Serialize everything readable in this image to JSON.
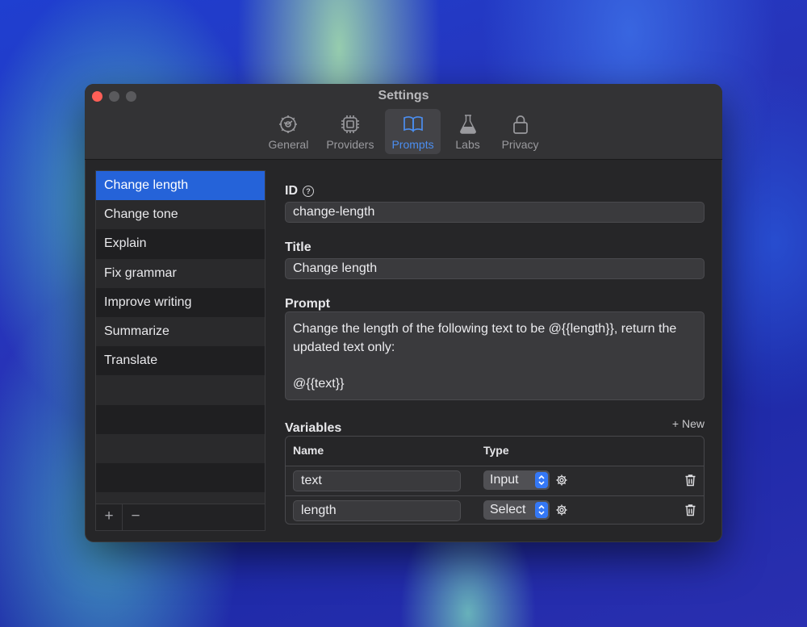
{
  "window": {
    "title": "Settings",
    "controls": [
      "close",
      "minimize",
      "zoom"
    ]
  },
  "toolbar": {
    "tabs": [
      {
        "label": "General",
        "icon": "gear-wheel-icon"
      },
      {
        "label": "Providers",
        "icon": "chip-icon"
      },
      {
        "label": "Prompts",
        "icon": "book-icon",
        "active": true
      },
      {
        "label": "Labs",
        "icon": "flask-icon"
      },
      {
        "label": "Privacy",
        "icon": "lock-icon"
      }
    ]
  },
  "sidebar": {
    "items": [
      {
        "label": "Change length",
        "selected": true
      },
      {
        "label": "Change tone"
      },
      {
        "label": "Explain"
      },
      {
        "label": "Fix grammar"
      },
      {
        "label": "Improve writing"
      },
      {
        "label": "Summarize"
      },
      {
        "label": "Translate"
      }
    ],
    "add_label": "+",
    "remove_label": "−"
  },
  "form": {
    "id_label": "ID",
    "help_glyph": "?",
    "id_value": "change-length",
    "title_label": "Title",
    "title_value": "Change length",
    "prompt_label": "Prompt",
    "prompt_line1": "Change the length of the following text to be @{{length}}, return the",
    "prompt_line2": "updated text only:",
    "prompt_line3": "@{{text}}",
    "variables_label": "Variables",
    "new_label": "+ New",
    "variables": {
      "col_name": "Name",
      "col_type": "Type",
      "rows": [
        {
          "name": "text",
          "type": "Input"
        },
        {
          "name": "length",
          "type": "Select"
        }
      ]
    }
  },
  "colors": {
    "accent": "#2563d9",
    "active_tab": "#4b8ef0",
    "close": "#ff5f57",
    "select_chevron": "#3478f6"
  }
}
